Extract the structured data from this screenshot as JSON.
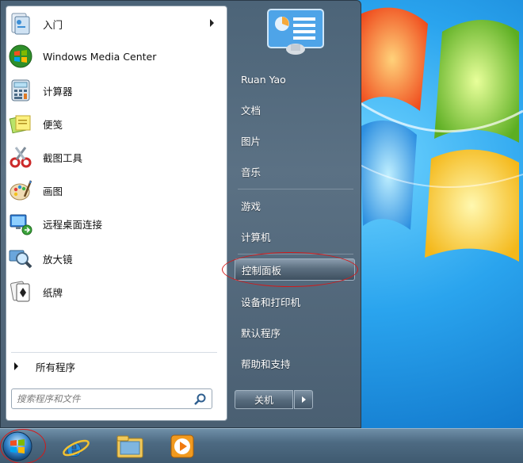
{
  "start_menu": {
    "programs": [
      {
        "label": "入门",
        "icon": "getting-started-icon",
        "has_submenu": true
      },
      {
        "label": "Windows Media Center",
        "icon": "media-center-icon",
        "has_submenu": false
      },
      {
        "label": "计算器",
        "icon": "calculator-icon",
        "has_submenu": false
      },
      {
        "label": "便笺",
        "icon": "sticky-notes-icon",
        "has_submenu": false
      },
      {
        "label": "截图工具",
        "icon": "scissors-icon",
        "has_submenu": false
      },
      {
        "label": "画图",
        "icon": "paint-palette-icon",
        "has_submenu": false
      },
      {
        "label": "远程桌面连接",
        "icon": "remote-desktop-icon",
        "has_submenu": false
      },
      {
        "label": "放大镜",
        "icon": "magnifier-icon",
        "has_submenu": false
      },
      {
        "label": "纸牌",
        "icon": "solitaire-cards-icon",
        "has_submenu": false
      }
    ],
    "all_programs_label": "所有程序",
    "search_placeholder": "搜索程序和文件",
    "right_items": [
      {
        "label": "Ruan Yao"
      },
      {
        "label": "文档"
      },
      {
        "label": "图片"
      },
      {
        "label": "音乐"
      },
      {
        "label": "游戏"
      },
      {
        "label": "计算机"
      },
      {
        "label": "控制面板",
        "highlighted": true
      },
      {
        "label": "设备和打印机"
      },
      {
        "label": "默认程序"
      },
      {
        "label": "帮助和支持"
      }
    ],
    "shutdown_label": "关机"
  },
  "taskbar": {
    "items": [
      "start-orb",
      "internet-explorer-icon",
      "file-explorer-icon",
      "media-player-icon"
    ]
  },
  "colors": {
    "highlight_ring": "#d21a1a"
  }
}
